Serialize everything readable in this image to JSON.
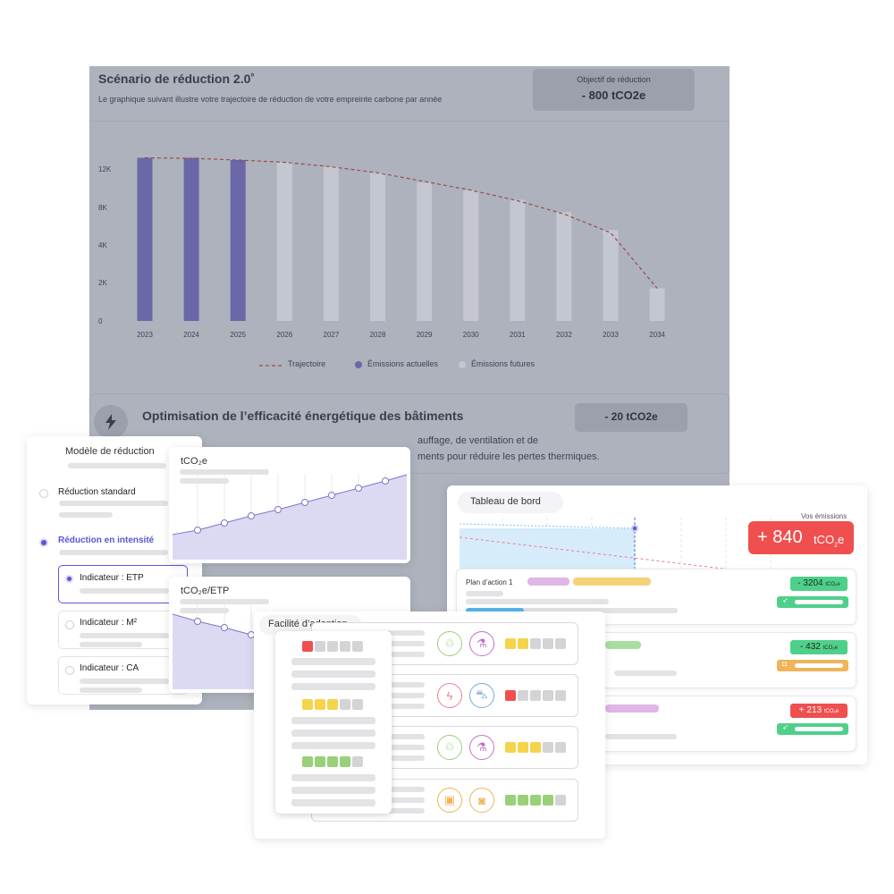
{
  "main_chart": {
    "title": "Scénario de réduction 2.0˚",
    "subtitle": "Le graphique suivant illustre votre trajectoire de réduction de votre empreinte carbone par année",
    "objective_label": "Objectif de réduction",
    "objective_value": "- 800 tCO2e",
    "legend_trajectory": "Trajectoire",
    "legend_current": "Émissions actuelles",
    "legend_future": "Émissions futures"
  },
  "chart_data": {
    "type": "bar",
    "categories": [
      "2023",
      "2024",
      "2025",
      "2026",
      "2027",
      "2028",
      "2029",
      "2030",
      "2031",
      "2032",
      "2033",
      "2034"
    ],
    "series": [
      {
        "name": "Émissions actuelles",
        "values": [
          13000,
          13000,
          12800,
          null,
          null,
          null,
          null,
          null,
          null,
          null,
          null,
          null
        ]
      },
      {
        "name": "Émissions futures",
        "values": [
          null,
          null,
          null,
          12600,
          12200,
          11600,
          10600,
          9800,
          8800,
          7500,
          5600,
          1700
        ]
      },
      {
        "name": "Trajectoire",
        "type": "line",
        "values": [
          13000,
          12950,
          12800,
          12600,
          12200,
          11600,
          10700,
          9800,
          8700,
          7300,
          5300,
          1700
        ]
      }
    ],
    "y_ticks": [
      "0",
      "2K",
      "4K",
      "8K",
      "12K"
    ],
    "ylim": [
      0,
      14000
    ],
    "grid": false,
    "legend_placement": "bottom",
    "colors": {
      "current": "#6a68a8",
      "future": "#c4c6d0",
      "trajectory": "#9c4a4a"
    }
  },
  "action": {
    "title": "Optimisation de l’efficacité énergétique des bâtiments",
    "value": "- 20 tCO2e",
    "text_line1": "auffage, de ventilation et de",
    "text_line2": "ments pour réduire les pertes thermiques."
  },
  "model": {
    "title": "Modèle de réduction",
    "opt_standard": "Réduction standard",
    "opt_intensity": "Réduction en intensité",
    "ind_etp": "Indicateur : ETP",
    "ind_m2": "Indicateur : M²",
    "ind_ca": "Indicateur : CA"
  },
  "mini1": {
    "label": "tCO₂e"
  },
  "mini2": {
    "label": "tCO₂e/ETP"
  },
  "adoption": {
    "title": "Facilité d’adoption"
  },
  "dashboard": {
    "title": "Tableau de bord",
    "emissions_label": "Vos émissions",
    "emissions_value": "+ 840",
    "emissions_unit": "tCO",
    "emissions_unit_sub": "2",
    "emissions_unit_end": "e",
    "plan1": "Plan d’action 1",
    "val1": "- 3204",
    "val2": "- 432",
    "val3": "+ 213",
    "unit_small": "tCO₂e"
  },
  "colors": {
    "accent": "#5b57d1",
    "overlay": "#aeb2bd",
    "red": "#f04f4f",
    "green": "#4fd08a",
    "yellow": "#f5d44b",
    "lightgreen": "#9bd07a",
    "orange": "#f0b45a",
    "pink": "#e0b6e6"
  }
}
